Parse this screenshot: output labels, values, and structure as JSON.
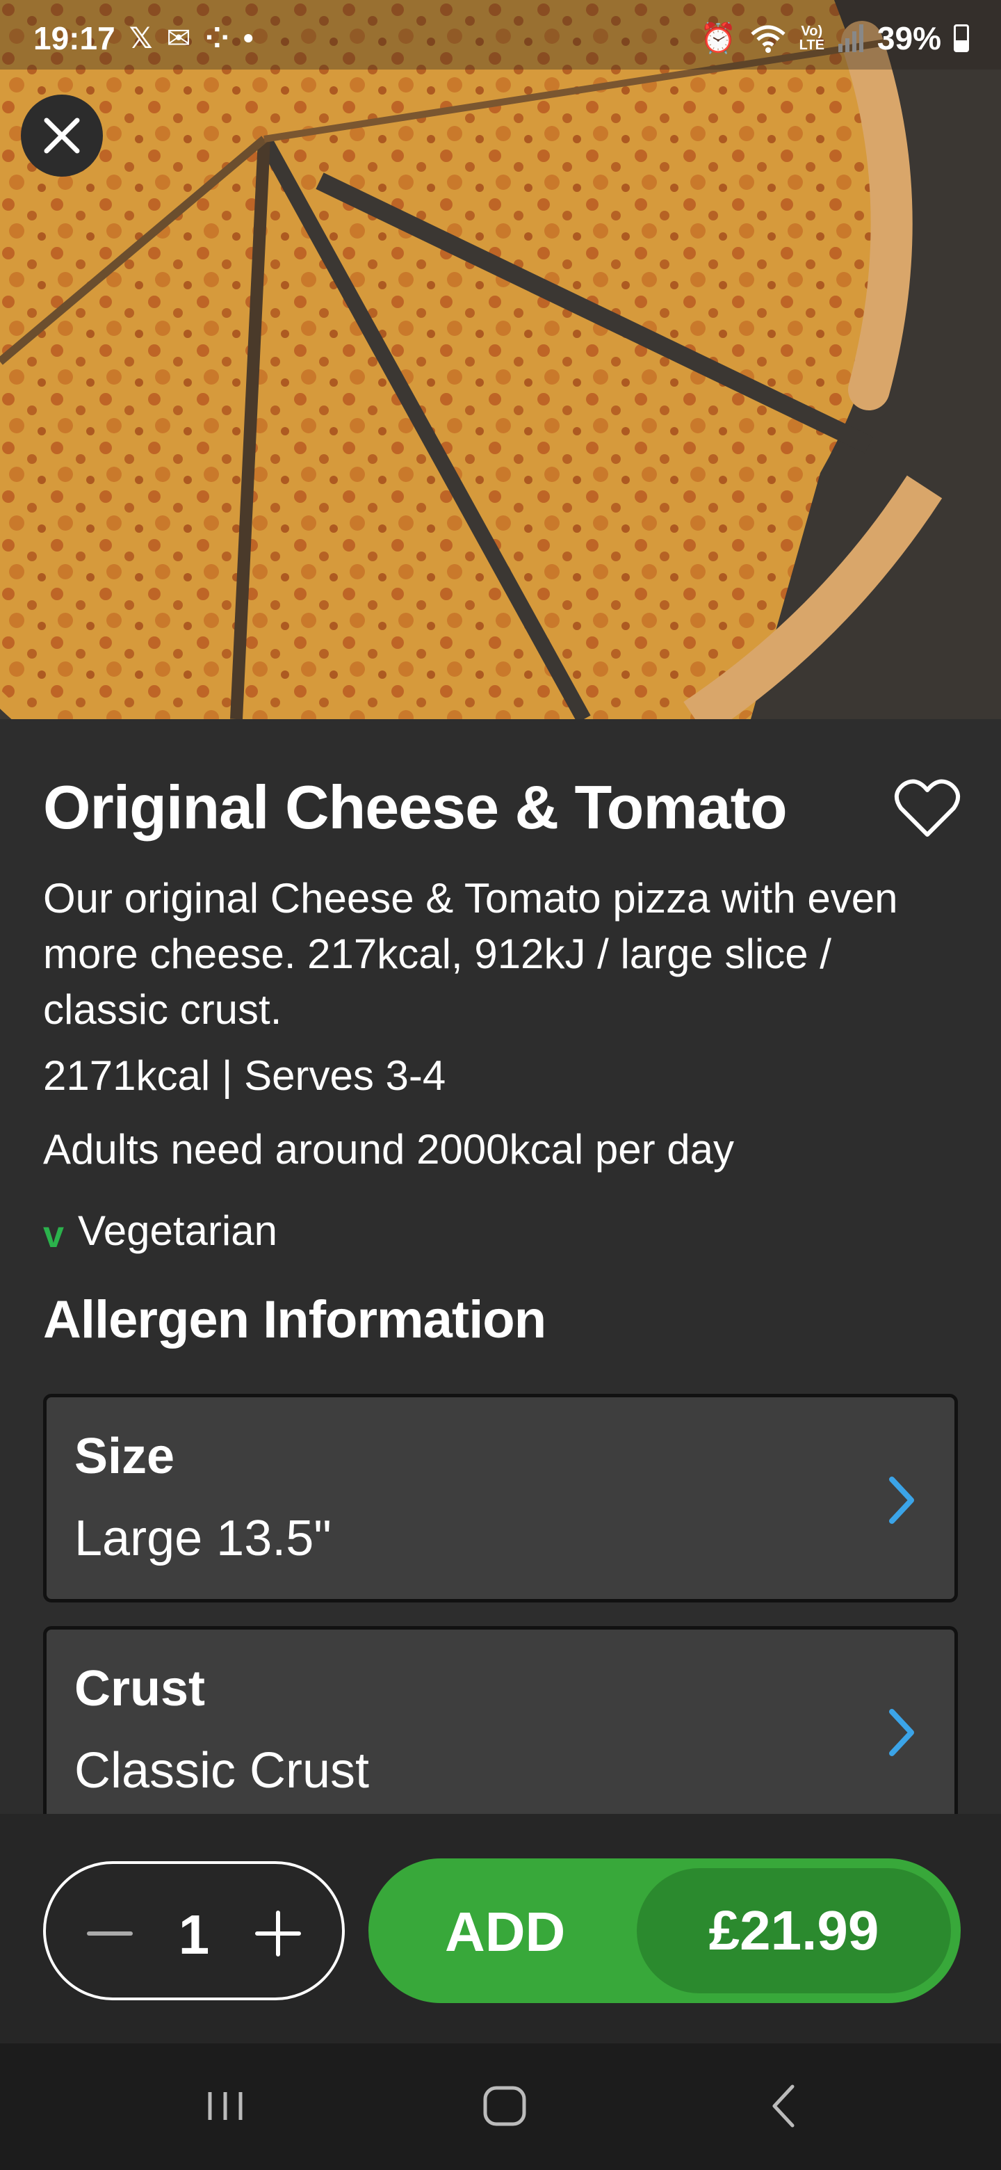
{
  "status_bar": {
    "time": "19:17",
    "left_icons": [
      "x-icon",
      "outlook-icon",
      "dominos-icon",
      "dot-icon"
    ],
    "right_icons": [
      "alarm-icon",
      "wifi-icon",
      "volte-icon",
      "signal-icon"
    ],
    "volte_label": "Vo)\nLTE",
    "battery": "39%"
  },
  "product": {
    "title": "Original Cheese & Tomato",
    "description": "Our original Cheese & Tomato pizza with even more cheese. 217kcal, 912kJ / large slice / classic crust.",
    "kcal_serves": "2171kcal | Serves 3-4",
    "adults_note": "Adults need around 2000kcal per day",
    "vegetarian_mark": "v",
    "vegetarian_label": "Vegetarian",
    "allergen_heading": "Allergen Information"
  },
  "options": [
    {
      "label": "Size",
      "value": "Large 13.5\""
    },
    {
      "label": "Crust",
      "value": "Classic Crust"
    }
  ],
  "action_bar": {
    "quantity": "1",
    "add_label": "ADD",
    "price": "£21.99"
  },
  "colors": {
    "background": "#2d2d2d",
    "card": "#3e3e3e",
    "accent_green": "#38a83a",
    "price_green": "#2b8a2e",
    "chevron_blue": "#3ba4e8",
    "veg_green": "#2bb24c"
  }
}
